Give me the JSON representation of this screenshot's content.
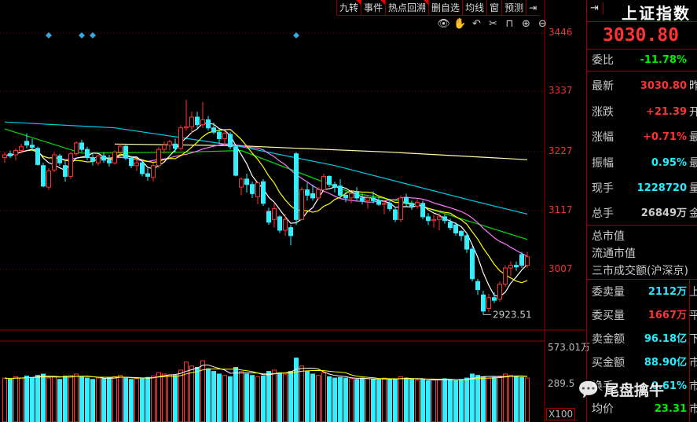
{
  "toolbar": {
    "items": [
      "九转",
      "事件",
      "热点回溯",
      "删自选",
      "均线",
      "窗",
      "预测"
    ],
    "marked": [
      true,
      true,
      true,
      false,
      false,
      false,
      false
    ],
    "collapse_icon": "arrow-right-bar-icon"
  },
  "chart_tools": [
    "eye-icon",
    "hand-icon",
    "undo-icon",
    "scissors-icon",
    "lock-icon",
    "zoom-in-icon",
    "zoom-out-icon"
  ],
  "colors": {
    "up": "#ff3333",
    "down": "#33eeff",
    "ma5": "#ffffff",
    "ma10": "#ffff00",
    "ma20": "#ff77ff",
    "ma30": "#00dd00",
    "ma60": "#00ccee",
    "ma250": "#ffffaa",
    "grid": "#880000"
  },
  "chart_data": {
    "type": "candlestick",
    "price_ticks": [
      "3446",
      "3337",
      "3227",
      "3117",
      "3007"
    ],
    "ylim": [
      2900,
      3446
    ],
    "low_label": "2923.51",
    "event_markers_at": [
      8,
      14,
      16,
      53
    ],
    "ohlc": [
      [
        3215,
        3225,
        3205,
        3220
      ],
      [
        3222,
        3228,
        3214,
        3218
      ],
      [
        3220,
        3232,
        3210,
        3228
      ],
      [
        3228,
        3240,
        3222,
        3235
      ],
      [
        3245,
        3260,
        3232,
        3238
      ],
      [
        3238,
        3250,
        3228,
        3234
      ],
      [
        3232,
        3235,
        3200,
        3202
      ],
      [
        3200,
        3205,
        3160,
        3162
      ],
      [
        3160,
        3195,
        3155,
        3190
      ],
      [
        3192,
        3225,
        3188,
        3220
      ],
      [
        3218,
        3222,
        3200,
        3205
      ],
      [
        3200,
        3210,
        3170,
        3180
      ],
      [
        3180,
        3225,
        3175,
        3222
      ],
      [
        3222,
        3245,
        3218,
        3242
      ],
      [
        3242,
        3248,
        3225,
        3230
      ],
      [
        3230,
        3235,
        3210,
        3215
      ],
      [
        3215,
        3222,
        3200,
        3208
      ],
      [
        3205,
        3220,
        3200,
        3218
      ],
      [
        3218,
        3225,
        3205,
        3210
      ],
      [
        3210,
        3220,
        3198,
        3205
      ],
      [
        3205,
        3228,
        3202,
        3225
      ],
      [
        3225,
        3240,
        3220,
        3236
      ],
      [
        3236,
        3238,
        3210,
        3214
      ],
      [
        3214,
        3218,
        3195,
        3200
      ],
      [
        3200,
        3210,
        3190,
        3205
      ],
      [
        3205,
        3208,
        3180,
        3185
      ],
      [
        3185,
        3195,
        3172,
        3180
      ],
      [
        3178,
        3205,
        3170,
        3200
      ],
      [
        3200,
        3235,
        3195,
        3230
      ],
      [
        3230,
        3245,
        3222,
        3238
      ],
      [
        3238,
        3248,
        3228,
        3244
      ],
      [
        3240,
        3250,
        3225,
        3232
      ],
      [
        3232,
        3275,
        3228,
        3270
      ],
      [
        3270,
        3322,
        3265,
        3272
      ],
      [
        3272,
        3300,
        3260,
        3290
      ],
      [
        3290,
        3300,
        3270,
        3276
      ],
      [
        3276,
        3318,
        3270,
        3285
      ],
      [
        3285,
        3292,
        3265,
        3270
      ],
      [
        3270,
        3280,
        3258,
        3262
      ],
      [
        3262,
        3268,
        3240,
        3250
      ],
      [
        3250,
        3265,
        3240,
        3260
      ],
      [
        3258,
        3262,
        3230,
        3235
      ],
      [
        3235,
        3238,
        3180,
        3182
      ],
      [
        3160,
        3178,
        3145,
        3175
      ],
      [
        3175,
        3185,
        3150,
        3165
      ],
      [
        3165,
        3170,
        3140,
        3148
      ],
      [
        3142,
        3168,
        3128,
        3168
      ],
      [
        3170,
        3175,
        3125,
        3130
      ],
      [
        3115,
        3122,
        3090,
        3095
      ],
      [
        3100,
        3132,
        3085,
        3120
      ],
      [
        3105,
        3108,
        3075,
        3080
      ],
      [
        3080,
        3110,
        3070,
        3100
      ],
      [
        3085,
        3090,
        3052,
        3070
      ],
      [
        3222,
        3225,
        3090,
        3100
      ],
      [
        3100,
        3160,
        3098,
        3155
      ],
      [
        3155,
        3168,
        3135,
        3145
      ],
      [
        3148,
        3165,
        3135,
        3140
      ],
      [
        3140,
        3160,
        3138,
        3155
      ],
      [
        3155,
        3185,
        3150,
        3180
      ],
      [
        3180,
        3182,
        3160,
        3165
      ],
      [
        3165,
        3170,
        3150,
        3160
      ],
      [
        3162,
        3175,
        3140,
        3145
      ],
      [
        3145,
        3152,
        3132,
        3140
      ],
      [
        3140,
        3150,
        3130,
        3148
      ],
      [
        3150,
        3160,
        3135,
        3140
      ],
      [
        3140,
        3148,
        3128,
        3135
      ],
      [
        3135,
        3145,
        3120,
        3140
      ],
      [
        3140,
        3152,
        3130,
        3135
      ],
      [
        3135,
        3142,
        3125,
        3128
      ],
      [
        3128,
        3135,
        3110,
        3130
      ],
      [
        3130,
        3138,
        3115,
        3120
      ],
      [
        3118,
        3122,
        3095,
        3100
      ],
      [
        3100,
        3145,
        3095,
        3140
      ],
      [
        3140,
        3148,
        3125,
        3130
      ],
      [
        3130,
        3135,
        3118,
        3125
      ],
      [
        3125,
        3138,
        3120,
        3132
      ],
      [
        3130,
        3135,
        3100,
        3105
      ],
      [
        3105,
        3112,
        3090,
        3098
      ],
      [
        3098,
        3110,
        3085,
        3100
      ],
      [
        3100,
        3112,
        3080,
        3105
      ],
      [
        3105,
        3110,
        3092,
        3098
      ],
      [
        3095,
        3102,
        3080,
        3085
      ],
      [
        3090,
        3095,
        3070,
        3075
      ],
      [
        3078,
        3080,
        3060,
        3070
      ],
      [
        3070,
        3075,
        3038,
        3045
      ],
      [
        3045,
        3050,
        2985,
        2990
      ],
      [
        2985,
        2990,
        2960,
        2970
      ],
      [
        2960,
        2968,
        2923.51,
        2930
      ],
      [
        2935,
        2962,
        2928,
        2955
      ],
      [
        2955,
        2965,
        2945,
        2950
      ],
      [
        2952,
        2985,
        2948,
        2980
      ],
      [
        2980,
        3015,
        2975,
        3010
      ],
      [
        3010,
        3022,
        2995,
        3015
      ],
      [
        3015,
        3022,
        3005,
        3012
      ],
      [
        3035,
        3040,
        3010,
        3015
      ],
      [
        3015,
        3040,
        3010,
        3030.8
      ]
    ],
    "ma30_points": [
      [
        0,
        3268
      ],
      [
        14,
        3223
      ],
      [
        33,
        3225
      ],
      [
        43,
        3228
      ],
      [
        63,
        3150
      ],
      [
        74,
        3130
      ],
      [
        95,
        3063
      ]
    ],
    "ma60_points": [
      [
        0,
        3281
      ],
      [
        20,
        3270
      ],
      [
        42,
        3237
      ],
      [
        60,
        3200
      ],
      [
        85,
        3135
      ],
      [
        95,
        3110
      ]
    ],
    "ma250_points": [
      [
        20,
        3240
      ],
      [
        42,
        3237
      ],
      [
        70,
        3225
      ],
      [
        95,
        3211
      ]
    ],
    "volume_ticks": [
      "573.01万",
      "289.5"
    ],
    "volume_ylim": [
      0,
      580
    ],
    "volume_unit": "X100",
    "volumes": [
      330,
      320,
      340,
      330,
      345,
      335,
      350,
      360,
      330,
      340,
      320,
      345,
      350,
      360,
      340,
      330,
      320,
      330,
      325,
      335,
      340,
      350,
      330,
      320,
      325,
      330,
      335,
      345,
      370,
      360,
      355,
      350,
      390,
      450,
      420,
      410,
      460,
      400,
      380,
      360,
      350,
      340,
      410,
      380,
      360,
      350,
      340,
      345,
      380,
      390,
      370,
      360,
      380,
      480,
      420,
      380,
      360,
      350,
      370,
      340,
      330,
      335,
      330,
      325,
      320,
      330,
      325,
      320,
      315,
      330,
      320,
      325,
      340,
      330,
      320,
      315,
      320,
      310,
      315,
      320,
      325,
      315,
      310,
      320,
      330,
      360,
      350,
      340,
      330,
      335,
      345,
      360,
      350,
      340,
      335,
      330
    ]
  },
  "panel": {
    "collapse_icon": "arrow-right-bar-icon",
    "title": "上证指数",
    "price": "3030.80",
    "rows_top": [
      {
        "label": "委比",
        "value": "-11.78%",
        "color": "grn",
        "suffix": ""
      },
      {
        "label": "最新",
        "value": "3030.80",
        "color": "red",
        "suffix": "昨"
      },
      {
        "label": "涨跌",
        "value": "+21.39",
        "color": "red",
        "suffix": "开"
      },
      {
        "label": "涨幅",
        "value": "+0.71%",
        "color": "red",
        "suffix": "最"
      },
      {
        "label": "振幅",
        "value": "0.95%",
        "color": "cyn",
        "suffix": "最"
      },
      {
        "label": "现手",
        "value": "1228720",
        "color": "cyn",
        "suffix": "量"
      },
      {
        "label": "总手",
        "value": "26849万",
        "color": "gry",
        "suffix": "金"
      }
    ],
    "rows_mid": [
      "总市值",
      "流通市值",
      "三市成交额(沪深京)"
    ],
    "rows_bottom": [
      {
        "label": "委卖量",
        "value": "2112万",
        "color": "cyn",
        "suffix": "上"
      },
      {
        "label": "委买量",
        "value": "1667万",
        "color": "red",
        "suffix": "平"
      },
      {
        "label": "卖金额",
        "value": "96.18亿",
        "color": "cyn",
        "suffix": "下"
      },
      {
        "label": "买金额",
        "value": "88.90亿",
        "color": "cyn",
        "suffix": "市"
      },
      {
        "label": "换手",
        "value": "0.61%",
        "color": "cyn",
        "suffix": "市"
      },
      {
        "label": "均价",
        "value": "23.31",
        "color": "grn",
        "suffix": "市"
      }
    ]
  },
  "watermark": "尾盘擒牛"
}
